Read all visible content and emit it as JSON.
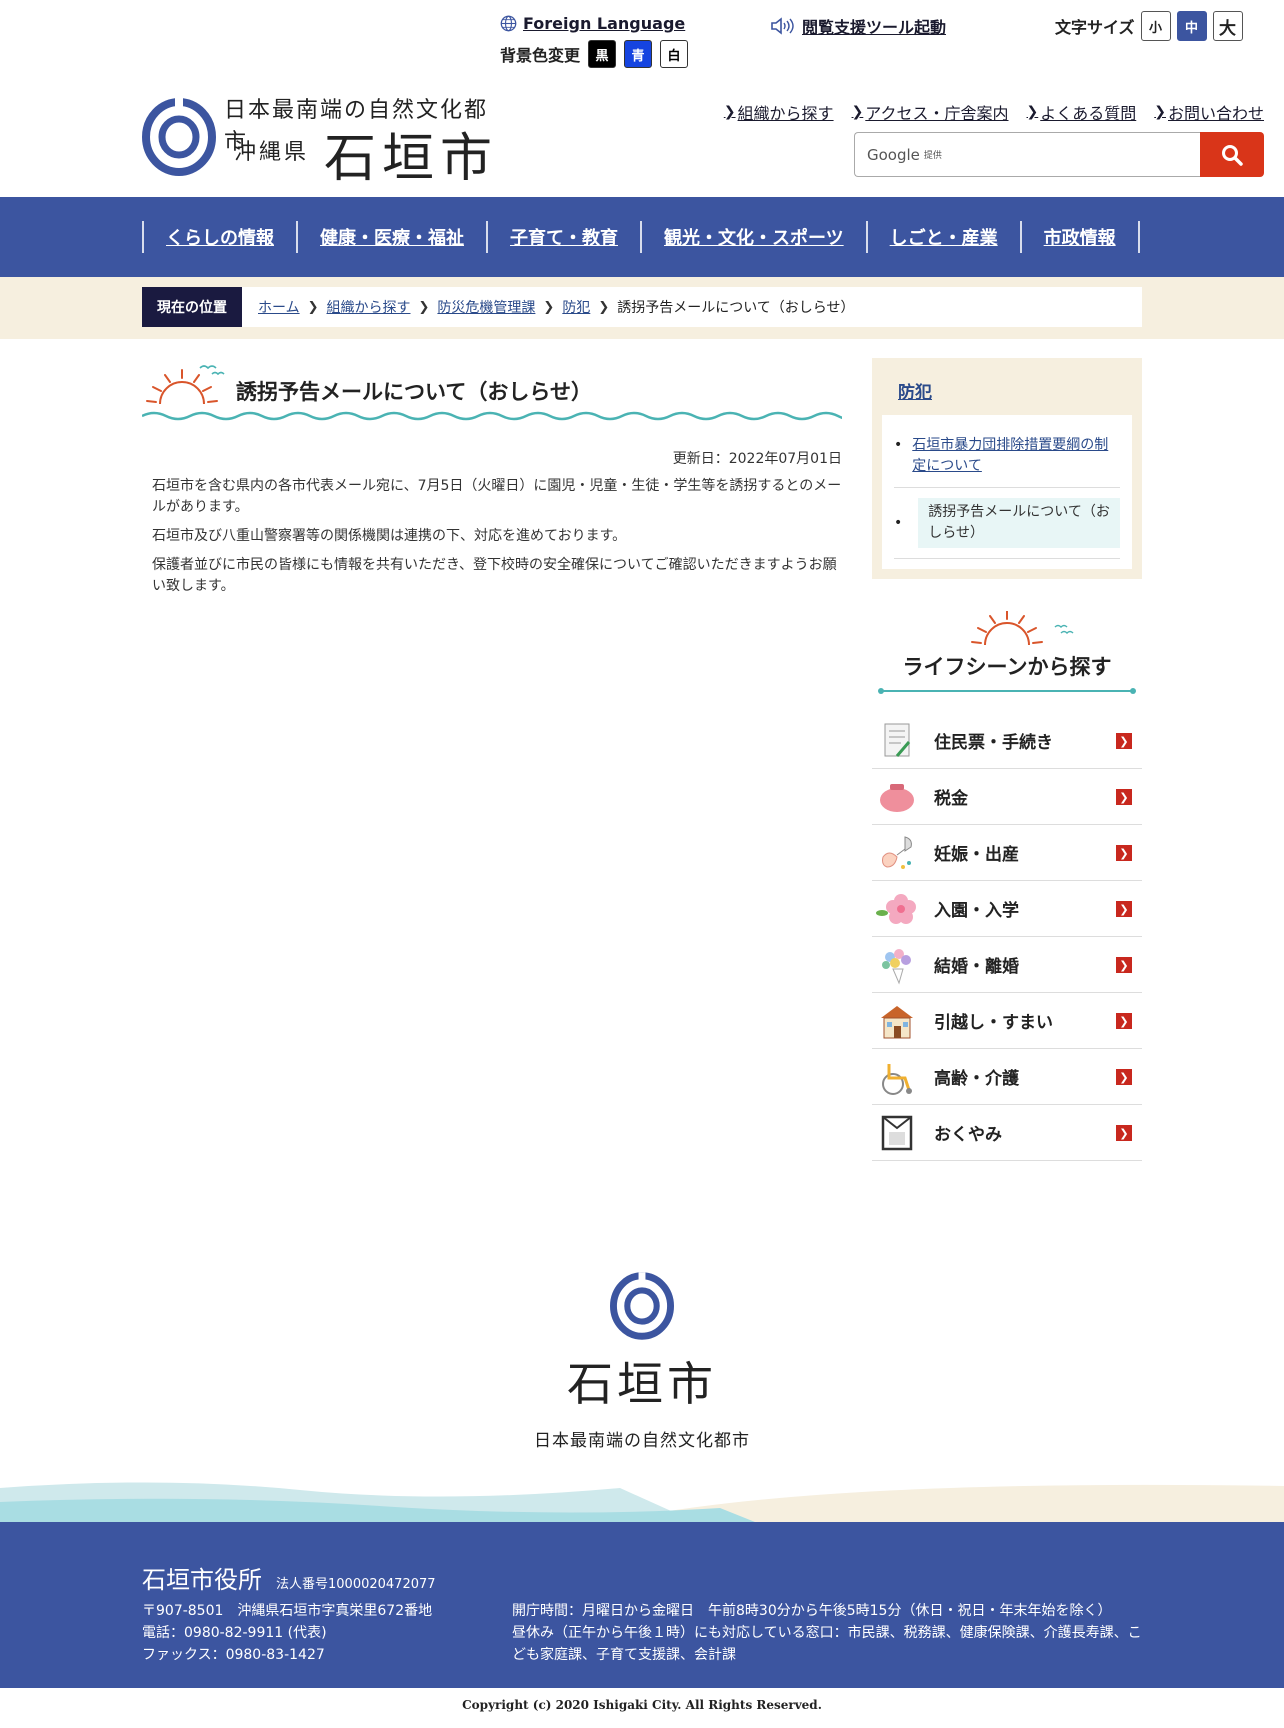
{
  "header": {
    "foreign_language": "Foreign Language",
    "bg_change_label": "背景色変更",
    "bg_options": [
      "黒",
      "青",
      "白"
    ],
    "reader_tool": "閲覧支援ツール起動",
    "font_size_label": "文字サイズ",
    "font_sizes": [
      "小",
      "中",
      "大"
    ],
    "logo": {
      "tagline": "日本最南端の自然文化都市",
      "prefecture": "沖縄県",
      "city": "石垣市"
    },
    "quick_links": [
      "組織から探す",
      "アクセス・庁舎案内",
      "よくある質問",
      "お問い合わせ"
    ],
    "search": {
      "provider": "Google",
      "provider_sub": "提供"
    }
  },
  "nav": [
    "くらしの情報",
    "健康・医療・福祉",
    "子育て・教育",
    "観光・文化・スポーツ",
    "しごと・産業",
    "市政情報"
  ],
  "breadcrumb": {
    "label": "現在の位置",
    "items": [
      "ホーム",
      "組織から探す",
      "防災危機管理課",
      "防犯"
    ],
    "current": "誘拐予告メールについて（おしらせ）"
  },
  "main": {
    "title": "誘拐予告メールについて（おしらせ）",
    "updated": "更新日：2022年07月01日",
    "paragraphs": [
      "石垣市を含む県内の各市代表メール宛に、7月5日（火曜日）に園児・児童・生徒・学生等を誘拐するとのメールがあります。",
      "石垣市及び八重山警察署等の関係機関は連携の下、対応を進めております。",
      "保護者並びに市民の皆様にも情報を共有いただき、登下校時の安全確保についてご確認いただきますようお願い致します。"
    ]
  },
  "side": {
    "category": "防犯",
    "links": [
      "石垣市暴力団排除措置要綱の制定について"
    ],
    "current": "誘拐予告メールについて（おしらせ）",
    "life_title": "ライフシーンから探す",
    "life_items": [
      {
        "label": "住民票・手続き",
        "icon": "document-icon"
      },
      {
        "label": "税金",
        "icon": "purse-icon"
      },
      {
        "label": "妊娠・出産",
        "icon": "stork-icon"
      },
      {
        "label": "入園・入学",
        "icon": "cherry-blossom-icon"
      },
      {
        "label": "結婚・離婚",
        "icon": "bouquet-icon"
      },
      {
        "label": "引越し・すまい",
        "icon": "house-icon"
      },
      {
        "label": "高齢・介護",
        "icon": "wheelchair-icon"
      },
      {
        "label": "おくやみ",
        "icon": "mourning-frame-icon"
      }
    ]
  },
  "footer": {
    "city": "石垣市",
    "tagline": "日本最南端の自然文化都市",
    "office": "石垣市役所",
    "corp_number": "法人番号1000020472077",
    "postal": "〒907-8501　沖縄県石垣市字真栄里672番地",
    "tel": "電話：0980-82-9911 (代表)",
    "fax": "ファックス：0980-83-1427",
    "hours": "開庁時間：月曜日から金曜日　午前8時30分から午後5時15分（休日・祝日・年末年始を除く）",
    "lunch": "昼休み（正午から午後１時）にも対応している窓口：市民課、税務課、健康保険課、介護長寿課、こども家庭課、子育て支援課、会計課",
    "copyright": "Copyright (c) 2020 Ishigaki City. All Rights Reserved."
  },
  "colors": {
    "primary": "#3c55a0",
    "search_button": "#d93519",
    "breadcrumb_bg": "#f6efdf",
    "arrow": "#c8281e",
    "wave": "#4ab3b3"
  }
}
